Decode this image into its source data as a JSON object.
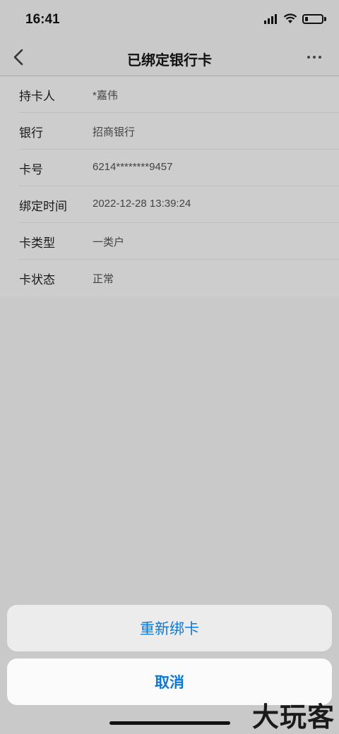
{
  "status_bar": {
    "time": "16:41",
    "icons": [
      "signal-icon",
      "wifi-icon",
      "battery-icon"
    ],
    "battery_level": 0.2
  },
  "nav": {
    "title": "已绑定银行卡",
    "back_icon": "chevron-left-icon",
    "more_icon": "more-horizontal-icon"
  },
  "card_info": [
    {
      "label": "持卡人",
      "value": "*嘉伟"
    },
    {
      "label": "银行",
      "value": "招商银行"
    },
    {
      "label": "卡号",
      "value": "6214********9457"
    },
    {
      "label": "绑定时间",
      "value": "2022-12-28 13:39:24"
    },
    {
      "label": "卡类型",
      "value": "一类户"
    },
    {
      "label": "卡状态",
      "value": "正常"
    }
  ],
  "action_sheet": {
    "rebind_label": "重新绑卡",
    "cancel_label": "取消"
  },
  "watermark": "大玩客",
  "colors": {
    "accent": "#0a78d6",
    "overlay_bg": "#c9c9c9"
  }
}
